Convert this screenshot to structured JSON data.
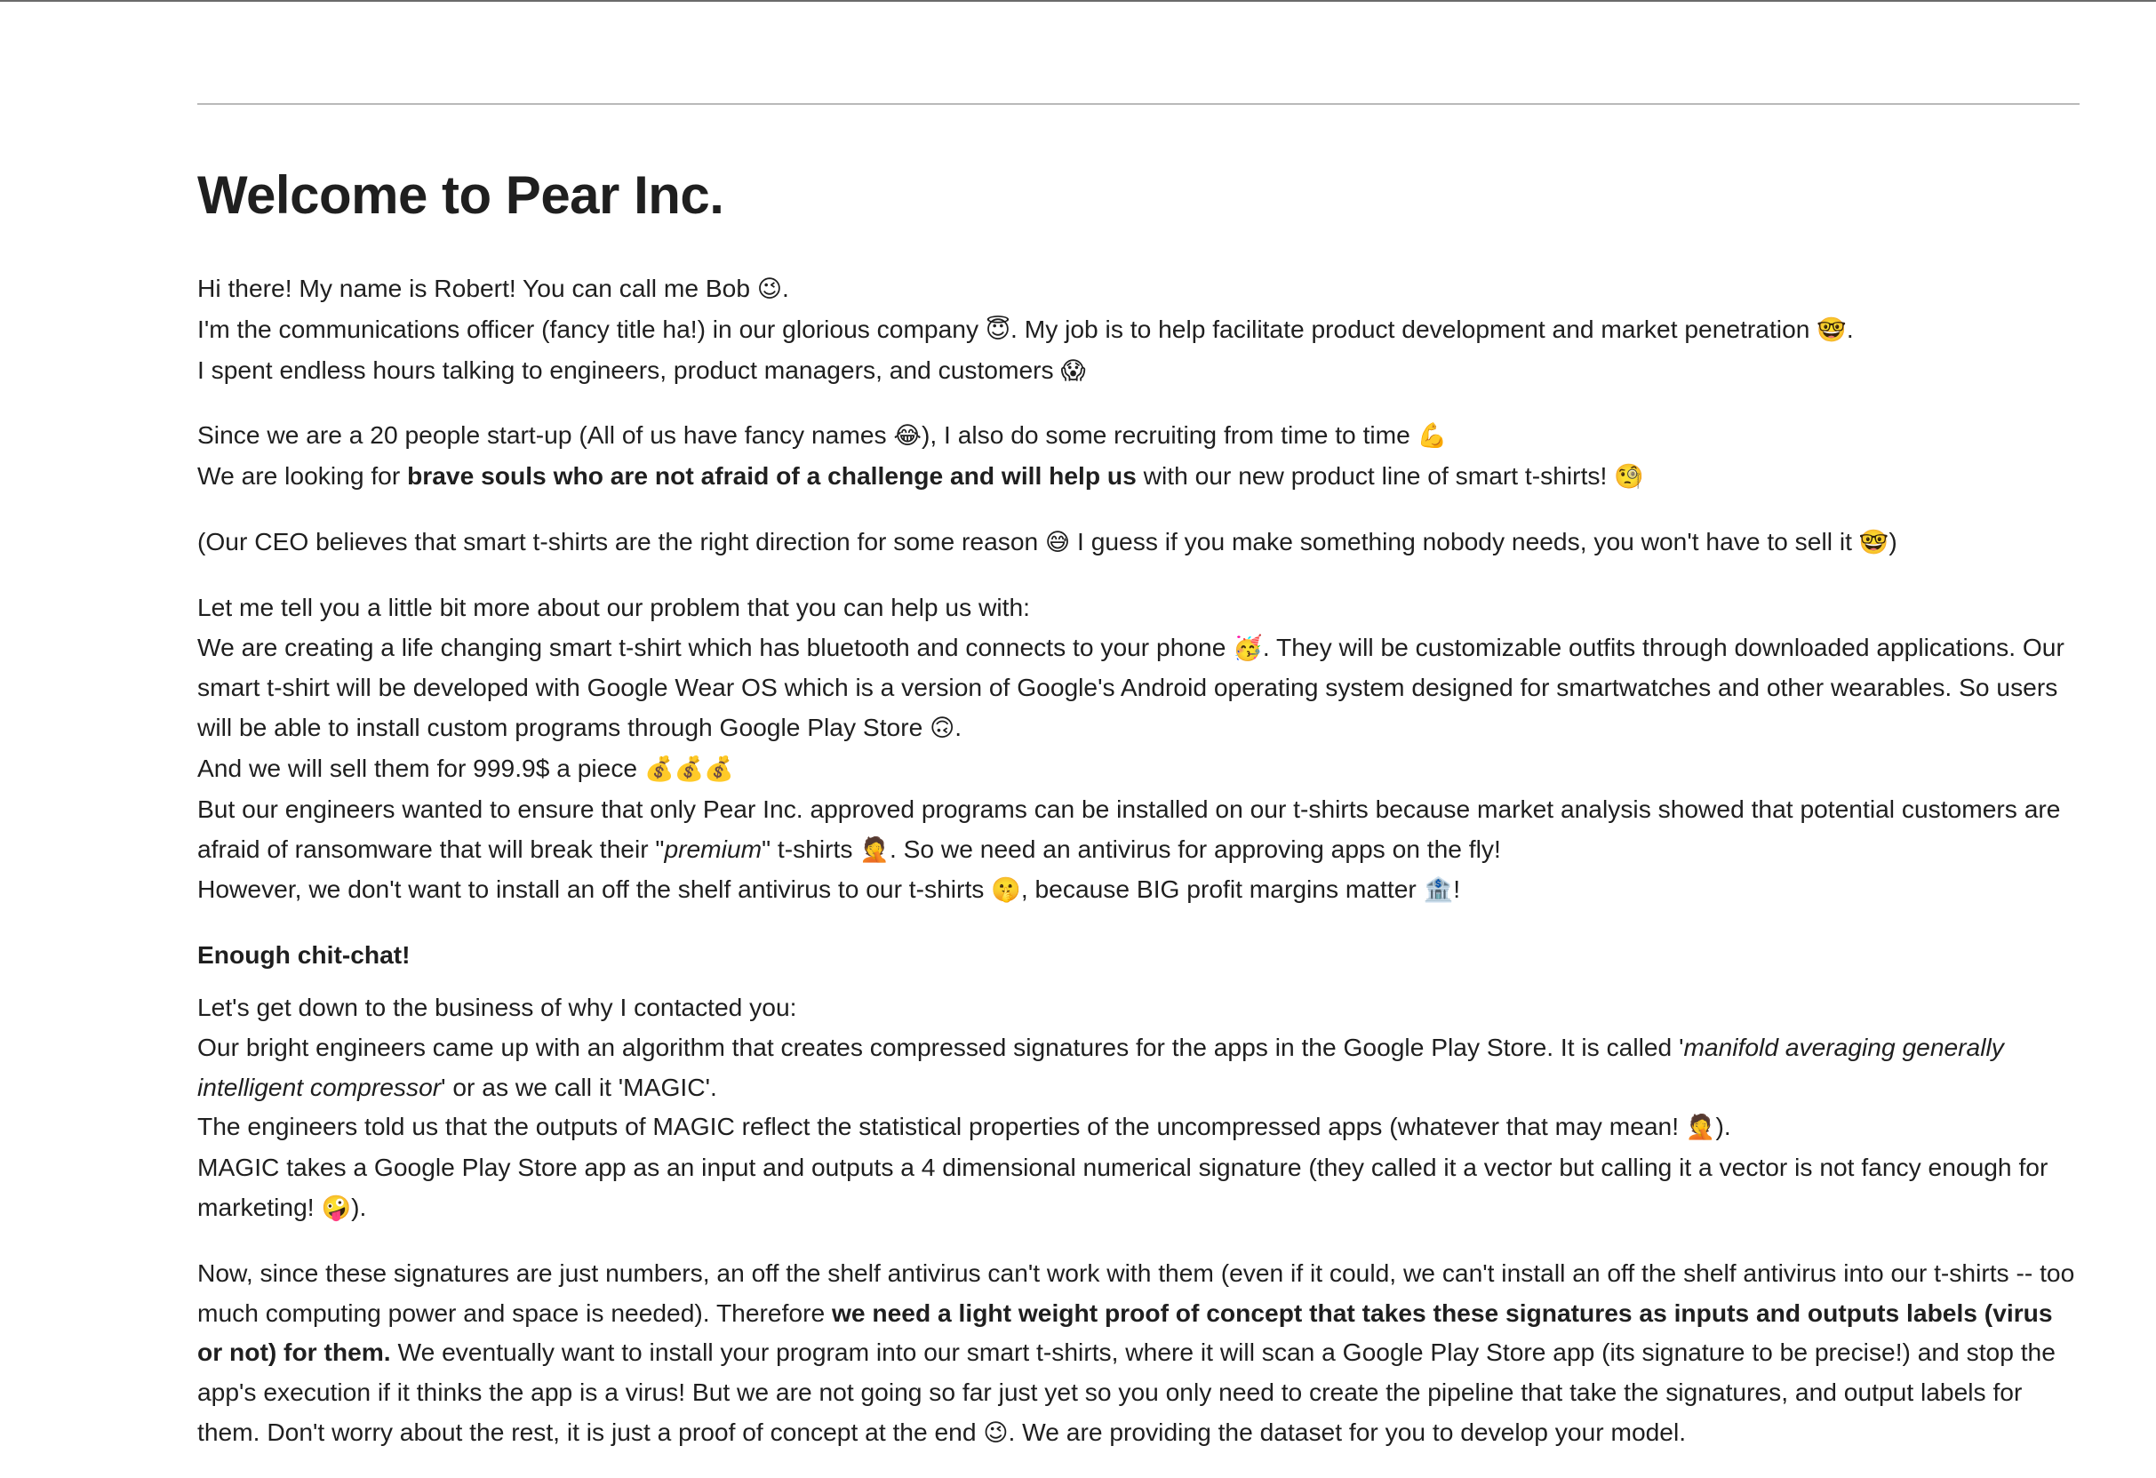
{
  "title": "Welcome to Pear Inc.",
  "p1": {
    "a": "Hi there! My name is Robert! You can call me Bob ",
    "emoji_wink": "😉",
    "b": ".",
    "c": "I'm the communications officer (fancy title ha!) in our glorious company ",
    "emoji_halo": "😇",
    "d": ". My job is to help facilitate product development and market penetration ",
    "emoji_nerd": "🤓",
    "e": ".",
    "f": "I spent endless hours talking to engineers, product managers, and customers ",
    "emoji_scream": "😱"
  },
  "p2": {
    "a": "Since we are a 20 people start-up (All of us have fancy names ",
    "emoji_joy": "😂",
    "b": "), I also do some recruiting from time to time ",
    "emoji_muscle": "💪",
    "c": "We are looking for ",
    "bold": "brave souls who are not afraid of a challenge and will help us",
    "d": " with our new product line of smart t-shirts! ",
    "emoji_think": "🧐"
  },
  "p3": {
    "a": "(Our CEO believes that smart t-shirts are the right direction for some reason ",
    "emoji_sweat": "😅",
    "b": " I guess if you make something nobody needs, you won't have to sell it ",
    "emoji_nerd": "🤓",
    "c": ")"
  },
  "p4": {
    "a": "Let me tell you a little bit more about our problem that you can help us with:",
    "b": "We are creating a life changing smart t-shirt which has bluetooth and connects to your phone ",
    "emoji_party": "🥳",
    "c": ". They will be customizable outfits through downloaded applications. Our smart t-shirt will be developed with Google Wear OS which is a version of Google's Android operating system designed for smartwatches and other wearables. So users will be able to install custom programs through Google Play Store ",
    "emoji_smile": "🙃",
    "d": ".",
    "e": "And we will sell them for 999.9$ a piece ",
    "emoji_money": "💰💰💰",
    "f": "But our engineers wanted to ensure that only Pear Inc. approved programs can be installed on our t-shirts because market analysis showed that potential customers are afraid of ransomware that will break their \"",
    "italic": "premium",
    "g": "\" t-shirts ",
    "emoji_facepalm": "🤦",
    "h": ". So we need an antivirus for approving apps on the fly!",
    "i": "However, we don't want to install an off the shelf antivirus to our t-shirts ",
    "emoji_hush": "🤫",
    "j": ", because BIG profit margins matter ",
    "emoji_bank": "🏦",
    "k": "!"
  },
  "heading2": "Enough chit-chat!",
  "p5": {
    "a": "Let's get down to the business of why I contacted you:",
    "b": "Our bright engineers came up with an algorithm that creates compressed signatures for the apps in the Google Play Store. It is called '",
    "italic": "manifold averaging generally intelligent compressor",
    "c": "' or as we call it 'MAGIC'.",
    "d": "The engineers told us that the outputs of MAGIC reflect the statistical properties of the uncompressed apps (whatever that may mean! ",
    "emoji_facepalm": "🤦",
    "e": ").",
    "f": "MAGIC takes a Google Play Store app as an input and outputs a 4 dimensional numerical signature (they called it a vector but calling it a vector is not fancy enough for marketing! ",
    "emoji_zany": "🤪",
    "g": ")."
  },
  "p6": {
    "a": "Now, since these signatures are just numbers, an off the shelf antivirus can't work with them (even if it could, we can't install an off the shelf antivirus into our t-shirts -- too much computing power and space is needed). Therefore ",
    "bold": "we need a light weight proof of concept that takes these signatures as inputs and outputs labels (virus or not) for them.",
    "b": " We eventually want to install your program into our smart t-shirts, where it will scan a Google Play Store app (its signature to be precise!) and stop the app's execution if it thinks the app is a virus! But we are not going so far just yet so you only need to create the pipeline that take the signatures, and output labels for them. Don't worry about the rest, it is just a proof of concept at the end ",
    "emoji_wink": "😉",
    "c": ". We are providing the dataset for you to develop your model."
  }
}
